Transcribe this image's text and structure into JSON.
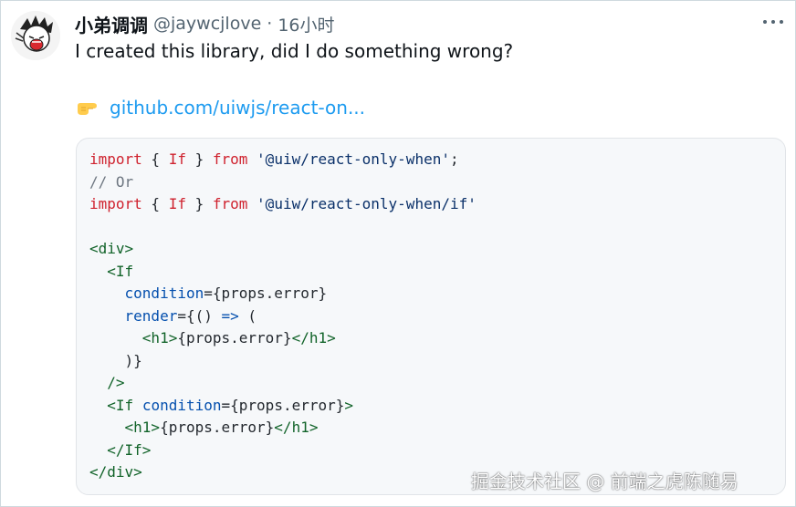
{
  "author": {
    "name": "小弟调调",
    "handle": "@jaywcjlove",
    "separator": "·",
    "time": "16小时"
  },
  "more_icon": "more-horizontal-icon",
  "tweet": {
    "text": "I created this library, did I do something wrong?",
    "link_emoji": "pointing-right-hand-emoji",
    "link_text": "github.com/uiwjs/react-on..."
  },
  "code_lines": [
    [
      {
        "t": "kw",
        "v": "import"
      },
      {
        "t": "plain",
        "v": " { "
      },
      {
        "t": "kw",
        "v": "If"
      },
      {
        "t": "plain",
        "v": " } "
      },
      {
        "t": "kw",
        "v": "from"
      },
      {
        "t": "plain",
        "v": " "
      },
      {
        "t": "str",
        "v": "'@uiw/react-only-when'"
      },
      {
        "t": "plain",
        "v": ";"
      }
    ],
    [
      {
        "t": "cmt",
        "v": "// Or"
      }
    ],
    [
      {
        "t": "kw",
        "v": "import"
      },
      {
        "t": "plain",
        "v": " { "
      },
      {
        "t": "kw",
        "v": "If"
      },
      {
        "t": "plain",
        "v": " } "
      },
      {
        "t": "kw",
        "v": "from"
      },
      {
        "t": "plain",
        "v": " "
      },
      {
        "t": "str",
        "v": "'@uiw/react-only-when/if'"
      }
    ],
    [],
    [
      {
        "t": "tag",
        "v": "<div>"
      }
    ],
    [
      {
        "t": "plain",
        "v": "  "
      },
      {
        "t": "tag",
        "v": "<If"
      }
    ],
    [
      {
        "t": "plain",
        "v": "    "
      },
      {
        "t": "attr",
        "v": "condition"
      },
      {
        "t": "plain",
        "v": "={props.error}"
      }
    ],
    [
      {
        "t": "plain",
        "v": "    "
      },
      {
        "t": "attr",
        "v": "render"
      },
      {
        "t": "plain",
        "v": "={() "
      },
      {
        "t": "op",
        "v": "=>"
      },
      {
        "t": "plain",
        "v": " ("
      }
    ],
    [
      {
        "t": "plain",
        "v": "      "
      },
      {
        "t": "tag",
        "v": "<h1>"
      },
      {
        "t": "plain",
        "v": "{props.error}"
      },
      {
        "t": "tag",
        "v": "</h1>"
      }
    ],
    [
      {
        "t": "plain",
        "v": "    )}"
      }
    ],
    [
      {
        "t": "plain",
        "v": "  "
      },
      {
        "t": "tag",
        "v": "/>"
      }
    ],
    [
      {
        "t": "plain",
        "v": "  "
      },
      {
        "t": "tag",
        "v": "<If"
      },
      {
        "t": "plain",
        "v": " "
      },
      {
        "t": "attr",
        "v": "condition"
      },
      {
        "t": "plain",
        "v": "={props.error}"
      },
      {
        "t": "tag",
        "v": ">"
      }
    ],
    [
      {
        "t": "plain",
        "v": "    "
      },
      {
        "t": "tag",
        "v": "<h1>"
      },
      {
        "t": "plain",
        "v": "{props.error}"
      },
      {
        "t": "tag",
        "v": "</h1>"
      }
    ],
    [
      {
        "t": "plain",
        "v": "  "
      },
      {
        "t": "tag",
        "v": "</If>"
      }
    ],
    [
      {
        "t": "tag",
        "v": "</div>"
      }
    ]
  ],
  "watermark": "掘金技术社区 @ 前端之虎陈随易"
}
